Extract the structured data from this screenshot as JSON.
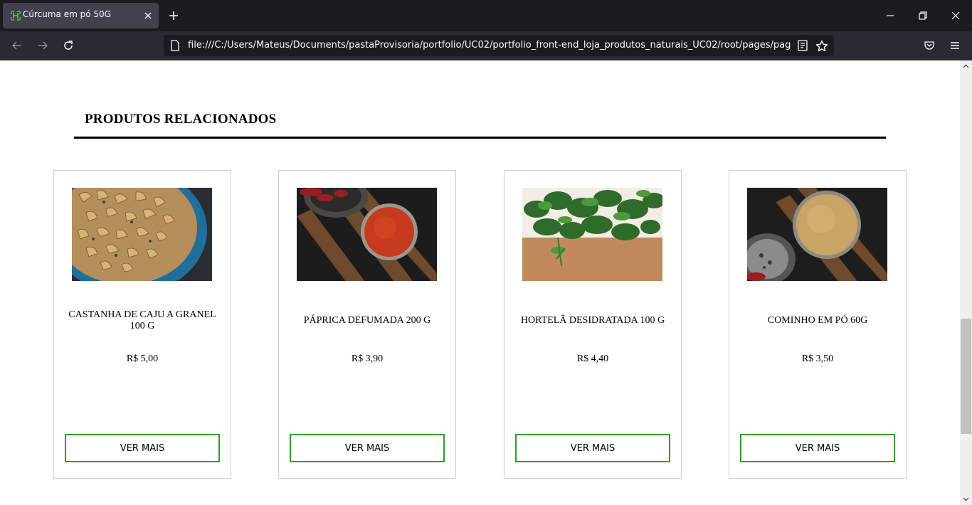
{
  "browser": {
    "tab": {
      "title": "Cúrcuma em pó 50G",
      "favicon": "h-leaf-favicon-icon"
    },
    "url": "file:///C:/Users/Mateus/Documents/pastaProvisoria/portfolio/UC02/portfolio_front-end_loja_produtos_naturais_UC02/root/pages/paginaDe",
    "colors": {
      "chrome_dark": "#1c1b22",
      "toolbar": "#2b2a33",
      "active_tab": "#42414d"
    }
  },
  "page": {
    "section_title": "PRODUTOS RELACIONADOS",
    "accent_color": "#339933",
    "products": [
      {
        "name": "CASTANHA DE CAJU A GRANEL 100 G",
        "price": "R$ 5,00",
        "button": "VER MAIS",
        "image": "cashews-bowl-photo"
      },
      {
        "name": "PÁPRICA DEFUMADA 200 G",
        "price": "R$ 3,90",
        "button": "VER MAIS",
        "image": "paprika-tin-photo"
      },
      {
        "name": "HORTELÃ DESIDRATADA 100 G",
        "price": "R$ 4,40",
        "button": "VER MAIS",
        "image": "mint-leaves-photo"
      },
      {
        "name": "COMINHO EM PÓ 60G",
        "price": "R$ 3,50",
        "button": "VER MAIS",
        "image": "cumin-tin-photo"
      }
    ]
  }
}
